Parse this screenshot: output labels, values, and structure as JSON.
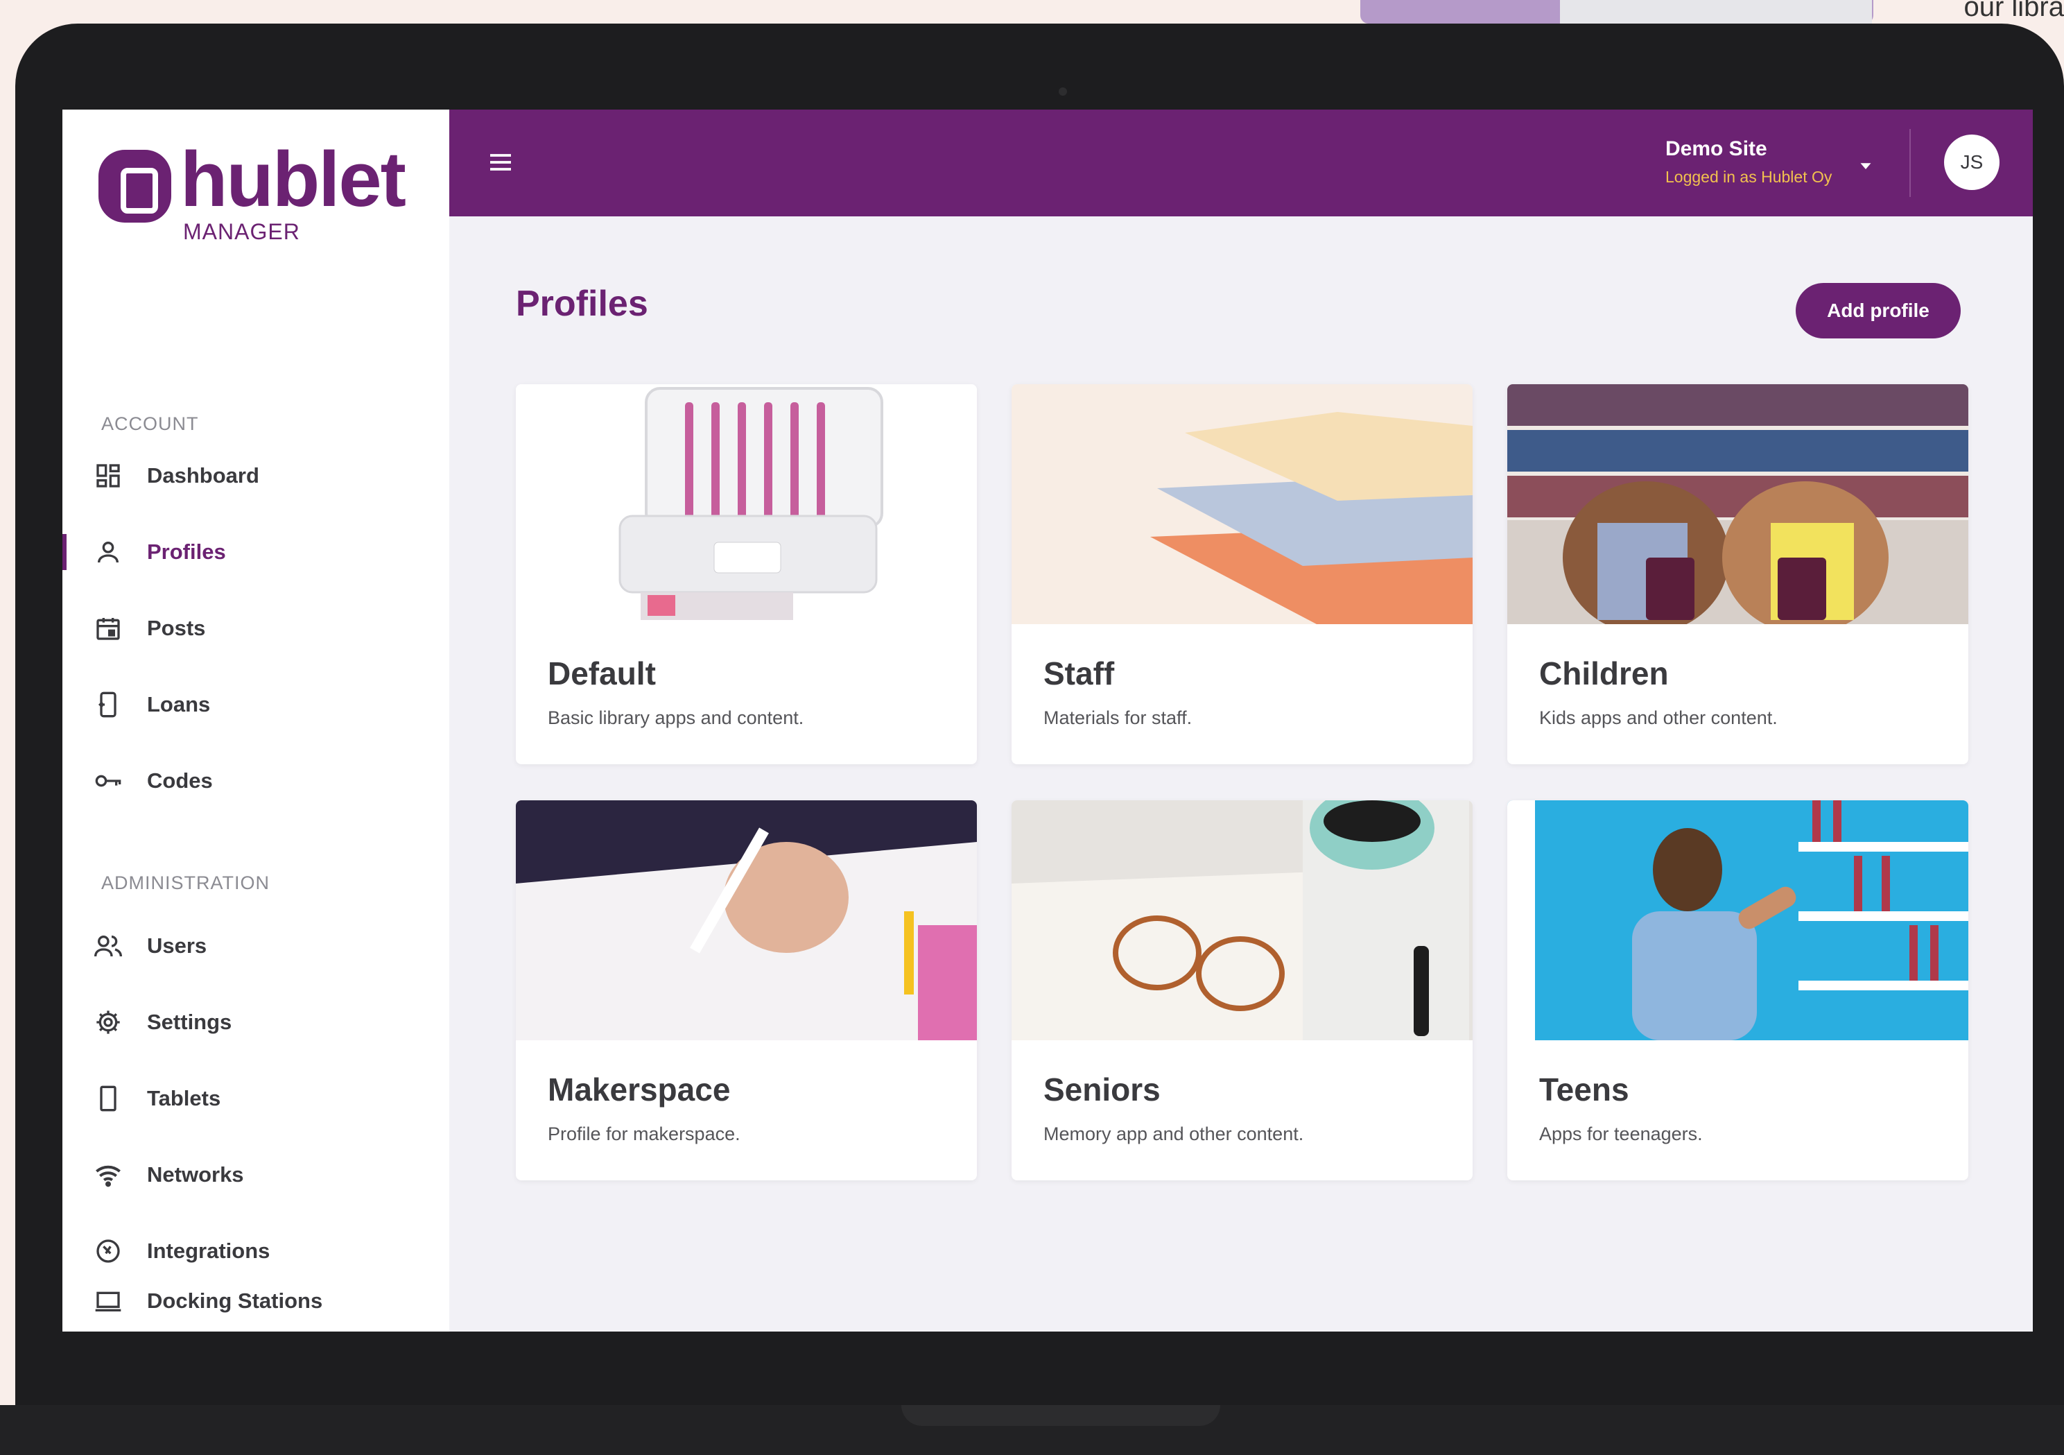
{
  "background": {
    "corner_text": "our libra"
  },
  "brand": {
    "name": "hublet",
    "sub": "MANAGER",
    "color": "#6b2272"
  },
  "sidebar": {
    "account_label": "ACCOUNT",
    "admin_label": "ADMINISTRATION",
    "account_items": [
      {
        "label": "Dashboard",
        "icon": "dashboard-icon"
      },
      {
        "label": "Profiles",
        "icon": "user-icon",
        "active": true
      },
      {
        "label": "Posts",
        "icon": "calendar-icon"
      },
      {
        "label": "Loans",
        "icon": "loan-icon"
      },
      {
        "label": "Codes",
        "icon": "key-icon"
      }
    ],
    "admin_items": [
      {
        "label": "Users",
        "icon": "users-icon"
      },
      {
        "label": "Settings",
        "icon": "gear-icon"
      },
      {
        "label": "Tablets",
        "icon": "tablet-icon"
      },
      {
        "label": "Networks",
        "icon": "wifi-icon"
      },
      {
        "label": "Integrations",
        "icon": "integration-icon"
      },
      {
        "label": "Docking Stations",
        "icon": "laptop-icon"
      }
    ]
  },
  "header": {
    "site_name": "Demo Site",
    "site_sub": "Logged in as Hublet Oy",
    "avatar_initials": "JS"
  },
  "main": {
    "title": "Profiles",
    "add_button": "Add profile",
    "profiles": [
      {
        "title": "Default",
        "description": "Basic library apps and content."
      },
      {
        "title": "Staff",
        "description": "Materials for staff."
      },
      {
        "title": "Children",
        "description": "Kids apps and other content."
      },
      {
        "title": "Makerspace",
        "description": "Profile for makerspace."
      },
      {
        "title": "Seniors",
        "description": "Memory app and other content."
      },
      {
        "title": "Teens",
        "description": "Apps for teenagers."
      }
    ]
  }
}
